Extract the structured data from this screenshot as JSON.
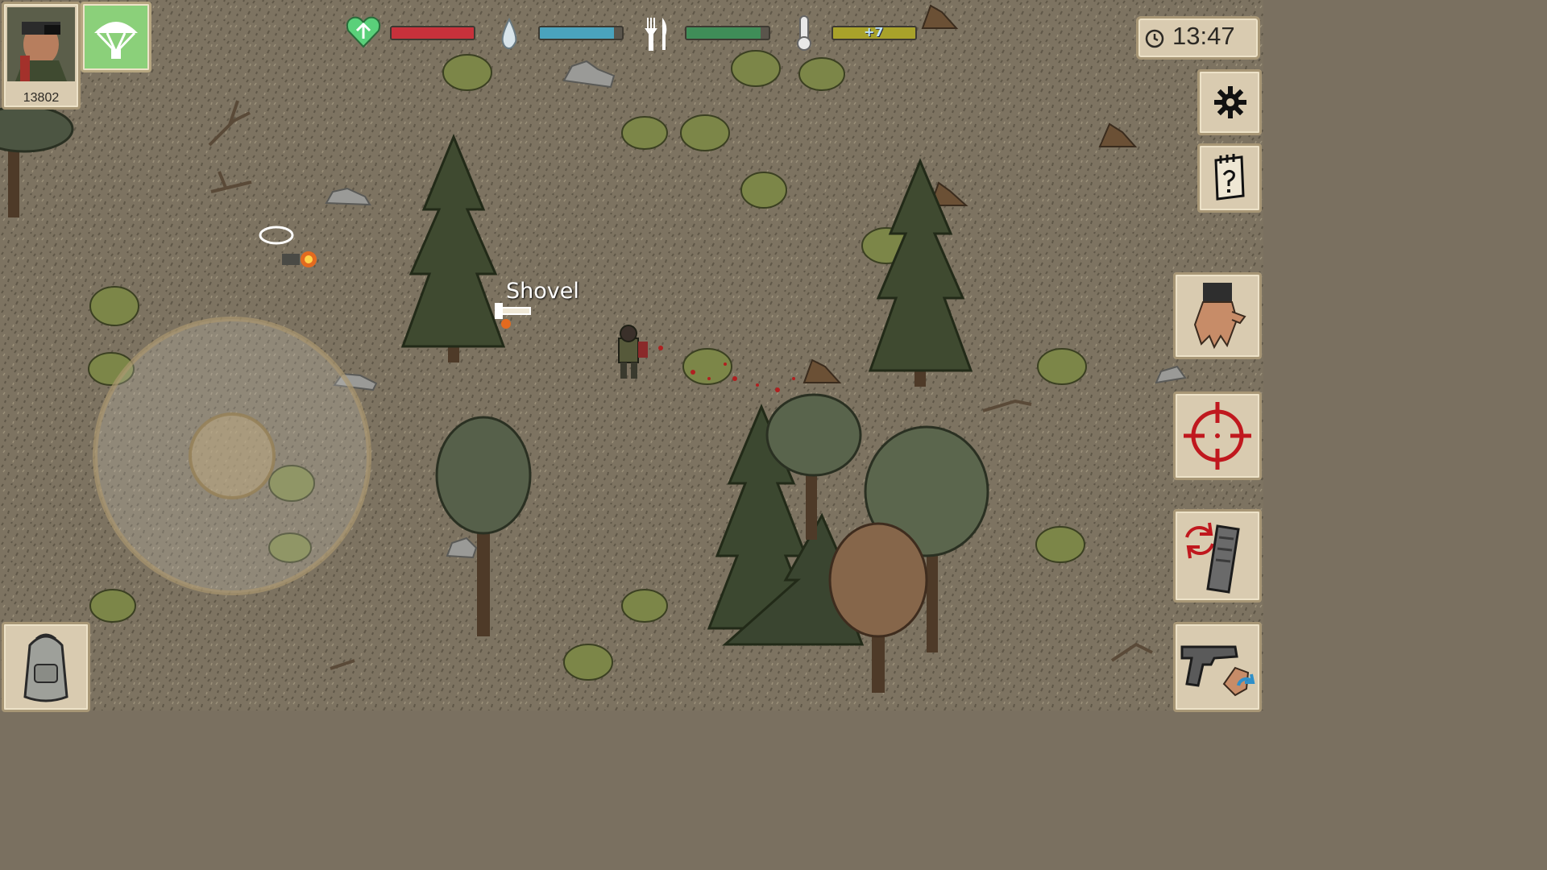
{
  "player": {
    "score": "13802"
  },
  "status": {
    "health": {
      "level": 1.0,
      "color": "#c7313b"
    },
    "thirst": {
      "level": 0.9,
      "color": "#4aa3bd"
    },
    "hunger": {
      "level": 0.9,
      "color": "#3f8d58"
    },
    "temperature": {
      "level": 1.0,
      "color": "#a8a22a",
      "label": "+7"
    }
  },
  "clock": {
    "time": "13:47"
  },
  "world": {
    "item_label": "Shovel"
  },
  "icons": {
    "portrait": "player-portrait",
    "airdrop": "parachute-icon",
    "health": "heart-icon",
    "thirst": "water-drop-icon",
    "hunger": "fork-knife-icon",
    "temperature": "thermometer-icon",
    "settings": "gear-icon",
    "quests": "notepad-question-icon",
    "interact": "hand-grab-icon",
    "aim": "crosshair-icon",
    "reload": "reload-magazine-icon",
    "weapon": "pistol-icon",
    "inventory": "backpack-icon"
  }
}
